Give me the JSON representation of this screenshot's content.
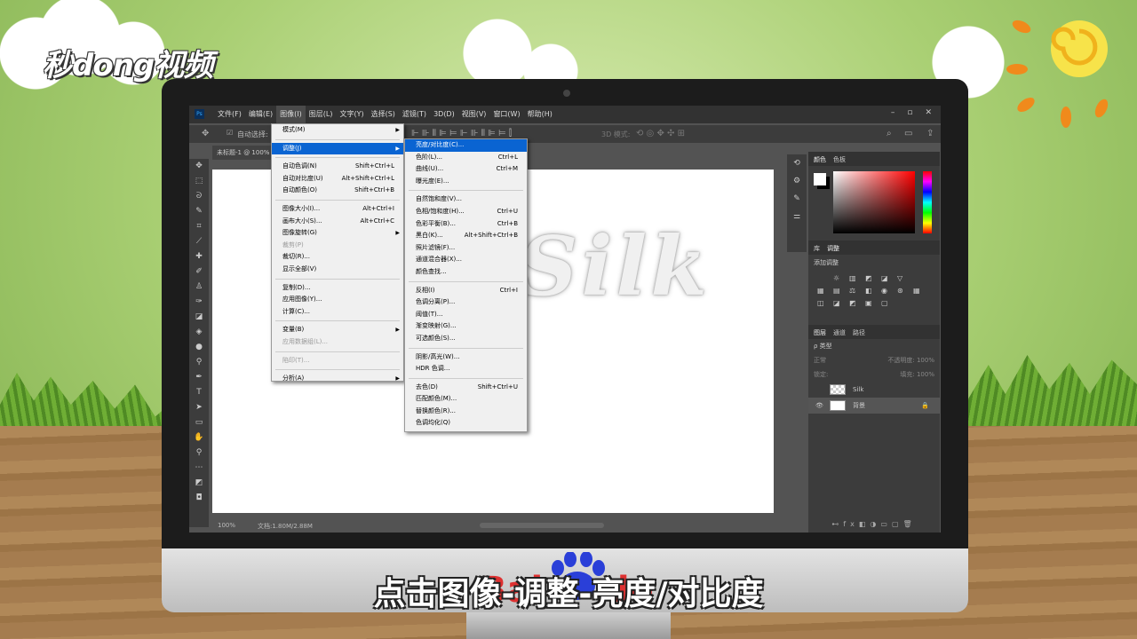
{
  "logo": {
    "text": "秒dong视频"
  },
  "subtitle": "点击图像-调整-亮度/对比度",
  "ps": {
    "app_badge": "Ps",
    "menubar": [
      "文件(F)",
      "编辑(E)",
      "图像(I)",
      "图层(L)",
      "文字(Y)",
      "选择(S)",
      "滤镜(T)",
      "3D(D)",
      "视图(V)",
      "窗口(W)",
      "帮助(H)"
    ],
    "active_menu": "图像(I)",
    "window_controls": [
      "–",
      "▫",
      "✕"
    ],
    "options": {
      "auto_select": "自动选择:",
      "mode_3d": "3D 模式:"
    },
    "doc_tab": "未标题-1 @ 100%",
    "status": {
      "zoom": "100%",
      "doc": "文档:1.80M/2.88M"
    },
    "canvas_text": "Silk",
    "image_menu": [
      {
        "label": "模式(M)",
        "shortcut": "",
        "arrow": true
      },
      {
        "sep": true
      },
      {
        "label": "调整(J)",
        "shortcut": "",
        "arrow": true,
        "hl": true
      },
      {
        "sep": true
      },
      {
        "label": "自动色调(N)",
        "shortcut": "Shift+Ctrl+L"
      },
      {
        "label": "自动对比度(U)",
        "shortcut": "Alt+Shift+Ctrl+L"
      },
      {
        "label": "自动颜色(O)",
        "shortcut": "Shift+Ctrl+B"
      },
      {
        "sep": true
      },
      {
        "label": "图像大小(I)...",
        "shortcut": "Alt+Ctrl+I"
      },
      {
        "label": "画布大小(S)...",
        "shortcut": "Alt+Ctrl+C"
      },
      {
        "label": "图像旋转(G)",
        "shortcut": "",
        "arrow": true
      },
      {
        "label": "裁剪(P)",
        "shortcut": "",
        "dis": true
      },
      {
        "label": "裁切(R)...",
        "shortcut": ""
      },
      {
        "label": "显示全部(V)",
        "shortcut": ""
      },
      {
        "sep": true
      },
      {
        "label": "复制(D)...",
        "shortcut": ""
      },
      {
        "label": "应用图像(Y)...",
        "shortcut": ""
      },
      {
        "label": "计算(C)...",
        "shortcut": ""
      },
      {
        "sep": true
      },
      {
        "label": "变量(B)",
        "shortcut": "",
        "arrow": true
      },
      {
        "label": "应用数据组(L)...",
        "shortcut": "",
        "dis": true
      },
      {
        "sep": true
      },
      {
        "label": "陷印(T)...",
        "shortcut": "",
        "dis": true
      },
      {
        "sep": true
      },
      {
        "label": "分析(A)",
        "shortcut": "",
        "arrow": true
      }
    ],
    "adjust_menu": [
      {
        "label": "亮度/对比度(C)...",
        "shortcut": "",
        "hl": true
      },
      {
        "label": "色阶(L)...",
        "shortcut": "Ctrl+L"
      },
      {
        "label": "曲线(U)...",
        "shortcut": "Ctrl+M"
      },
      {
        "label": "曝光度(E)...",
        "shortcut": ""
      },
      {
        "sep": true
      },
      {
        "label": "自然饱和度(V)...",
        "shortcut": ""
      },
      {
        "label": "色相/饱和度(H)...",
        "shortcut": "Ctrl+U"
      },
      {
        "label": "色彩平衡(B)...",
        "shortcut": "Ctrl+B"
      },
      {
        "label": "黑白(K)...",
        "shortcut": "Alt+Shift+Ctrl+B"
      },
      {
        "label": "照片滤镜(F)...",
        "shortcut": ""
      },
      {
        "label": "通道混合器(X)...",
        "shortcut": ""
      },
      {
        "label": "颜色查找...",
        "shortcut": ""
      },
      {
        "sep": true
      },
      {
        "label": "反相(I)",
        "shortcut": "Ctrl+I"
      },
      {
        "label": "色调分离(P)...",
        "shortcut": ""
      },
      {
        "label": "阈值(T)...",
        "shortcut": ""
      },
      {
        "label": "渐变映射(G)...",
        "shortcut": ""
      },
      {
        "label": "可选颜色(S)...",
        "shortcut": ""
      },
      {
        "sep": true
      },
      {
        "label": "阴影/高光(W)...",
        "shortcut": ""
      },
      {
        "label": "HDR 色调...",
        "shortcut": ""
      },
      {
        "sep": true
      },
      {
        "label": "去色(D)",
        "shortcut": "Shift+Ctrl+U"
      },
      {
        "label": "匹配颜色(M)...",
        "shortcut": ""
      },
      {
        "label": "替换颜色(R)...",
        "shortcut": ""
      },
      {
        "label": "色调均化(Q)",
        "shortcut": ""
      }
    ],
    "panels": {
      "color_tabs": [
        "颜色",
        "色板"
      ],
      "adjust_tabs": [
        "库",
        "调整"
      ],
      "add_adjust": "添加调整",
      "layer_tabs": [
        "图层",
        "通道",
        "路径"
      ],
      "kind": "ρ 类型",
      "blend": "正常",
      "opacity": "不透明度: 100%",
      "lock": "锁定:",
      "fill": "填充: 100%",
      "layers": [
        {
          "name": "Silk",
          "visible": false
        },
        {
          "name": "背景",
          "visible": true,
          "locked": true
        }
      ]
    }
  },
  "colors": {
    "highlight": "#0a64d2",
    "ps_dark": "#323232",
    "panel": "#3c3c3c"
  }
}
